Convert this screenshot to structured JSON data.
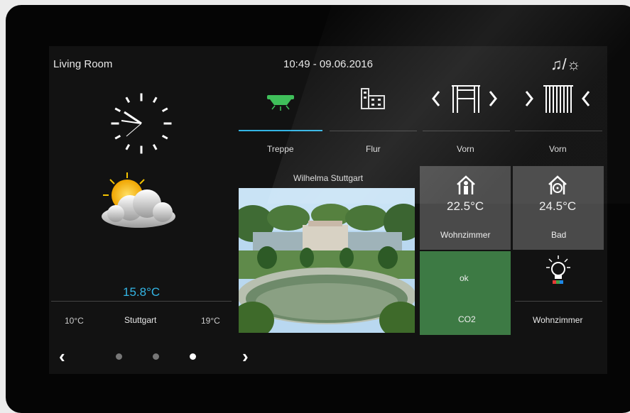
{
  "header": {
    "title": "Living Room",
    "datetime": "10:49 - 09.06.2016",
    "mode_icon": "music-light-icon"
  },
  "weather": {
    "current_temp": "15.8°C",
    "min_temp": "10°C",
    "city": "Stuttgart",
    "max_temp": "19°C",
    "condition_icon": "sun-cloud-icon"
  },
  "tabs": [
    {
      "label": "Treppe",
      "icon": "ceiling-light-icon",
      "active": true
    },
    {
      "label": "Flur",
      "icon": "building-icon",
      "active": false
    },
    {
      "label": "Vorn",
      "icon": "blind-open-icon",
      "active": false
    },
    {
      "label": "Vorn",
      "icon": "blind-close-icon",
      "active": false
    }
  ],
  "camera": {
    "title": "Wilhelma Stuttgart"
  },
  "tiles": {
    "wohnzimmer": {
      "temp": "22.5°C",
      "label": "Wohnzimmer"
    },
    "bad": {
      "temp": "24.5°C",
      "label": "Bad"
    },
    "co2": {
      "value": "ok",
      "label": "CO2"
    },
    "light": {
      "label": "Wohnzimmer"
    }
  },
  "pager": {
    "pages": 3,
    "active": 3
  },
  "colors": {
    "accent": "#33b5e5",
    "tile_gray": "#4a4a4a",
    "tile_green": "#3d7a44",
    "light_green": "#3fbf5a"
  }
}
